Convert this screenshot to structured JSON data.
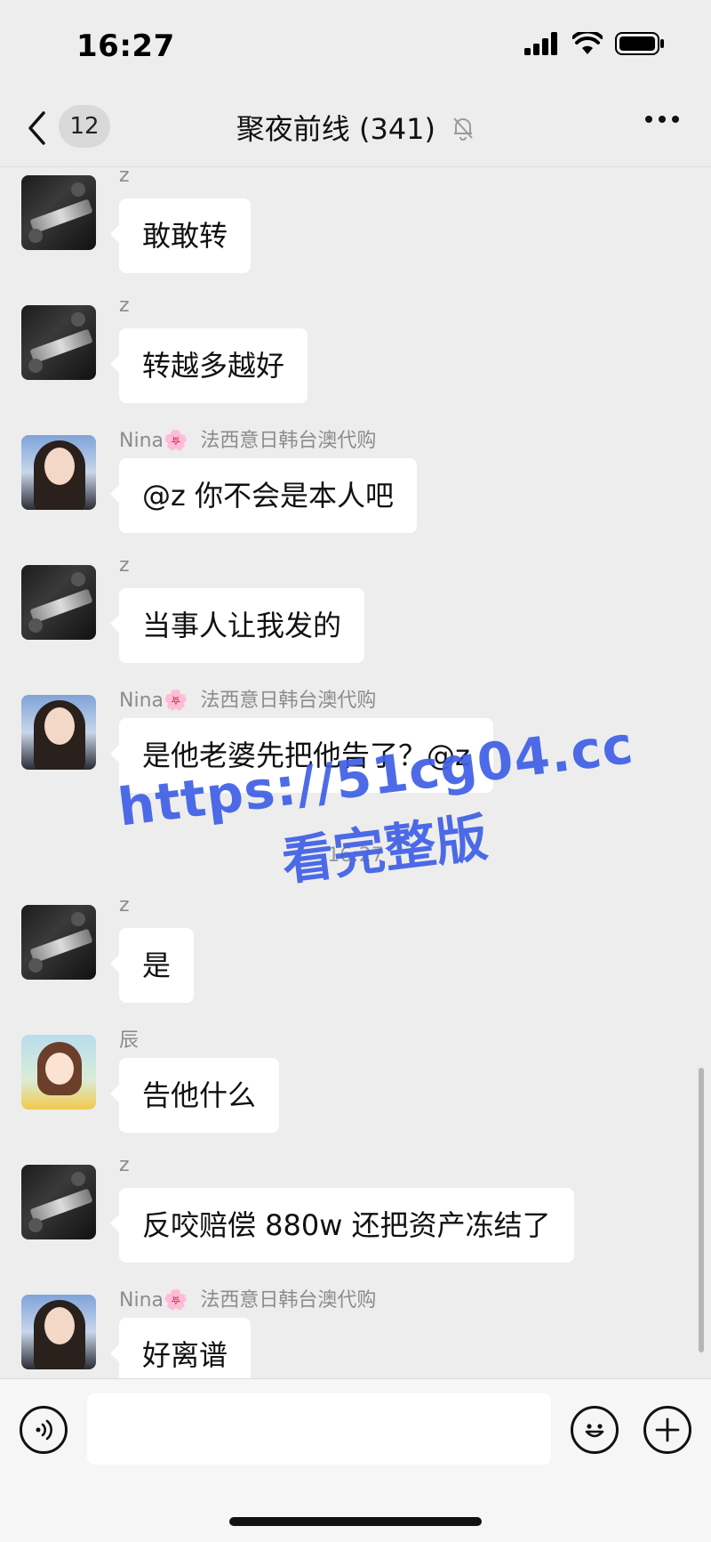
{
  "status_bar": {
    "time": "16:27"
  },
  "nav": {
    "back_count": "12",
    "title": "聚夜前线 (341)"
  },
  "messages": [
    {
      "sender": "z",
      "tag": "",
      "text": "敢敢转",
      "avatar": "z"
    },
    {
      "sender": "z",
      "tag": "",
      "text": "转越多越好",
      "avatar": "z"
    },
    {
      "sender": "Nina🌸",
      "tag": "法西意日韩台澳代购",
      "text": "@z 你不会是本人吧",
      "avatar": "nina"
    },
    {
      "sender": "z",
      "tag": "",
      "text": "当事人让我发的",
      "avatar": "z"
    },
    {
      "sender": "Nina🌸",
      "tag": "法西意日韩台澳代购",
      "text": "是他老婆先把他告了？@z",
      "avatar": "nina"
    },
    {
      "sender": "z",
      "tag": "",
      "text": "是",
      "avatar": "z"
    },
    {
      "sender": "辰",
      "tag": "",
      "text": "告他什么",
      "avatar": "chen"
    },
    {
      "sender": "z",
      "tag": "",
      "text": "反咬赔偿 880w 还把资产冻结了",
      "avatar": "z"
    },
    {
      "sender": "Nina🌸",
      "tag": "法西意日韩台澳代购",
      "text": "好离谱",
      "avatar": "nina"
    }
  ],
  "timestamp": "16:27",
  "watermark": {
    "line1": "https://51cg04.cc",
    "line2": "看完整版"
  },
  "input_bar": {
    "placeholder": "",
    "icons": [
      "voice-icon",
      "emoji-icon",
      "plus-icon"
    ]
  }
}
